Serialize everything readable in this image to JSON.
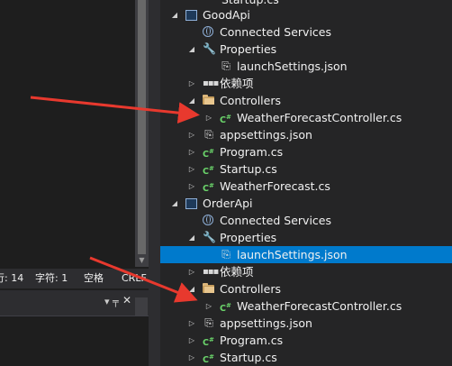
{
  "status_bar": {
    "line_partial": "行: 14",
    "char": "字符: 1",
    "spaces": "空格",
    "crlf": "CRLF"
  },
  "panel": {
    "pin_icon": "pin-icon",
    "close_icon": "close-icon"
  },
  "tree": {
    "top_partial": "Startup.cs",
    "rows": [
      {
        "label": "GoodApi",
        "icon": "project-icon",
        "arrow": "expanded"
      },
      {
        "label": "Connected Services",
        "icon": "connected-services-icon",
        "arrow": "none"
      },
      {
        "label": "Properties",
        "icon": "wrench-icon",
        "arrow": "expanded"
      },
      {
        "label": "launchSettings.json",
        "icon": "json-file-icon",
        "arrow": "none"
      },
      {
        "label": "依赖项",
        "icon": "dependencies-icon",
        "arrow": "collapsed"
      },
      {
        "label": "Controllers",
        "icon": "folder-icon",
        "arrow": "expanded"
      },
      {
        "label": "WeatherForecastController.cs",
        "icon": "csharp-file-icon",
        "arrow": "collapsed"
      },
      {
        "label": "appsettings.json",
        "icon": "json-file-icon",
        "arrow": "collapsed"
      },
      {
        "label": "Program.cs",
        "icon": "csharp-file-icon",
        "arrow": "collapsed"
      },
      {
        "label": "Startup.cs",
        "icon": "csharp-file-icon",
        "arrow": "collapsed"
      },
      {
        "label": "WeatherForecast.cs",
        "icon": "csharp-file-icon",
        "arrow": "collapsed"
      },
      {
        "label": "OrderApi",
        "icon": "project-icon",
        "arrow": "expanded"
      },
      {
        "label": "Connected Services",
        "icon": "connected-services-icon",
        "arrow": "none"
      },
      {
        "label": "Properties",
        "icon": "wrench-icon",
        "arrow": "expanded"
      },
      {
        "label": "launchSettings.json",
        "icon": "json-file-icon",
        "arrow": "none",
        "selected": true
      },
      {
        "label": "依赖项",
        "icon": "dependencies-icon",
        "arrow": "collapsed"
      },
      {
        "label": "Controllers",
        "icon": "folder-icon",
        "arrow": "expanded"
      },
      {
        "label": "WeatherForecastController.cs",
        "icon": "csharp-file-icon",
        "arrow": "collapsed"
      },
      {
        "label": "appsettings.json",
        "icon": "json-file-icon",
        "arrow": "collapsed"
      },
      {
        "label": "Program.cs",
        "icon": "csharp-file-icon",
        "arrow": "collapsed"
      },
      {
        "label": "Startup.cs",
        "icon": "csharp-file-icon",
        "arrow": "collapsed"
      }
    ]
  },
  "colors": {
    "selection": "#007acc",
    "annotation_arrow": "#e8392e",
    "csharp_icon": "#6bd56b",
    "folder": "#dcb67a"
  }
}
